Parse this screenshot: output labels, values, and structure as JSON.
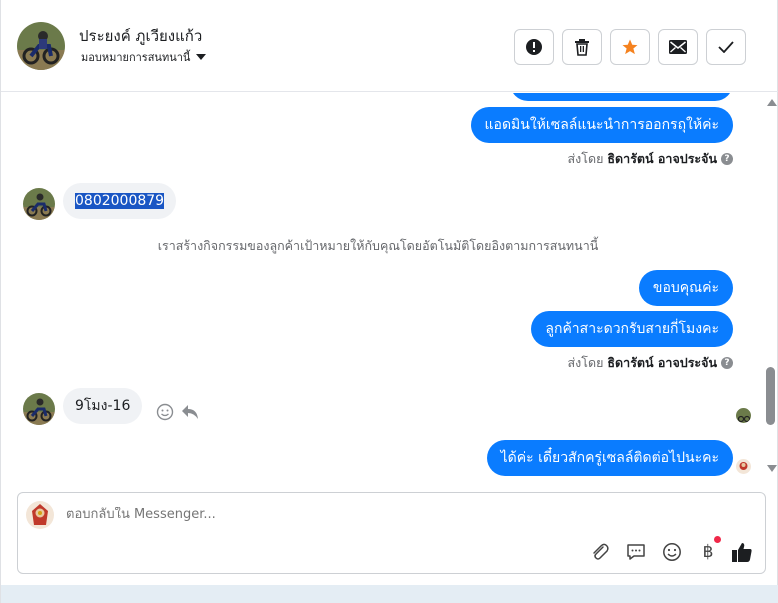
{
  "header": {
    "name": "ประยงค์ ภูเวียงแก้ว",
    "assign_label": "มอบหมายการสนทนานี้",
    "buttons": [
      "spam-report",
      "delete",
      "star",
      "mark-unread",
      "done"
    ]
  },
  "chat": {
    "messages": [
      {
        "side": "out",
        "text": "แอดมินให้เซลล์แนะนำการออกรถุให้ค่ะ"
      },
      {
        "side": "meta",
        "prefix": "ส่งโดย",
        "agent": "ธิดารัตน์ อาจประจัน"
      },
      {
        "side": "in",
        "text": "0802000879",
        "selected": true
      },
      {
        "side": "system",
        "text": "เราสร้างกิจกรรมของลูกค้าเป้าหมายให้กับคุณโดยอัตโนมัติโดยอิงตามการสนทนานี้"
      },
      {
        "side": "out",
        "text": "ขอบคุณค่ะ"
      },
      {
        "side": "out",
        "text": "ลูกค้าสาะดวกรับสายกี่โมงคะ"
      },
      {
        "side": "meta",
        "prefix": "ส่งโดย",
        "agent": "ธิดารัตน์ อาจประจัน"
      },
      {
        "side": "in",
        "text": "9โมง-16"
      },
      {
        "side": "out",
        "text": "ได้ค่ะ เดี๋ยวสักครู่เซลล์ติดต่อไปนะคะ"
      }
    ]
  },
  "composer": {
    "placeholder": "ตอบกลับใน Messenger...",
    "icons": [
      "attachment-icon",
      "saved-reply-icon",
      "emoji-icon",
      "baht-payment-icon",
      "like-icon"
    ]
  },
  "colors": {
    "bubble_out": "#0a7cff",
    "bubble_in": "#f0f2f5",
    "star": "#f5821f",
    "notification_dot": "#f02849"
  }
}
